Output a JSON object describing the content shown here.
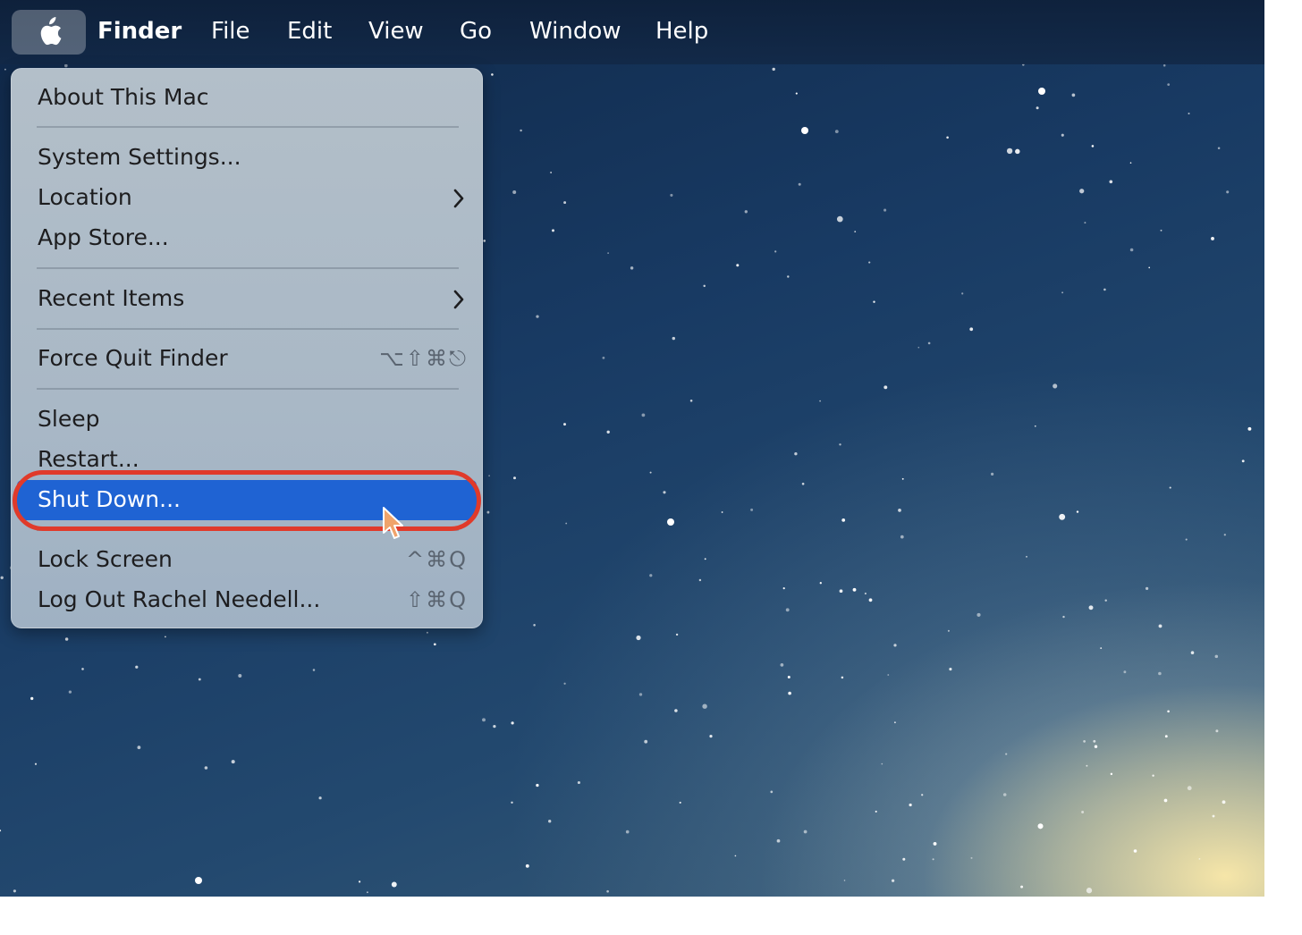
{
  "menubar": {
    "items": [
      {
        "label": "Finder",
        "bold": true
      },
      {
        "label": "File"
      },
      {
        "label": "Edit"
      },
      {
        "label": "View"
      },
      {
        "label": "Go"
      },
      {
        "label": "Window"
      },
      {
        "label": "Help"
      }
    ]
  },
  "apple_menu": {
    "about": "About This Mac",
    "system_settings": "System Settings...",
    "location": "Location",
    "app_store": "App Store...",
    "recent_items": "Recent Items",
    "force_quit": "Force Quit Finder",
    "force_quit_shortcut": "⌥⇧⌘⎋",
    "sleep": "Sleep",
    "restart": "Restart...",
    "shut_down": "Shut Down...",
    "lock_screen": "Lock Screen",
    "lock_screen_shortcut": "^⌘Q",
    "log_out": "Log Out Rachel Needell...",
    "log_out_shortcut": "⇧⌘Q"
  },
  "colors": {
    "highlight": "#1f63d3",
    "annotation_ring": "#e03a2a"
  },
  "icons": [
    "apple-logo-icon",
    "chevron-right-icon",
    "mouse-pointer-icon"
  ]
}
